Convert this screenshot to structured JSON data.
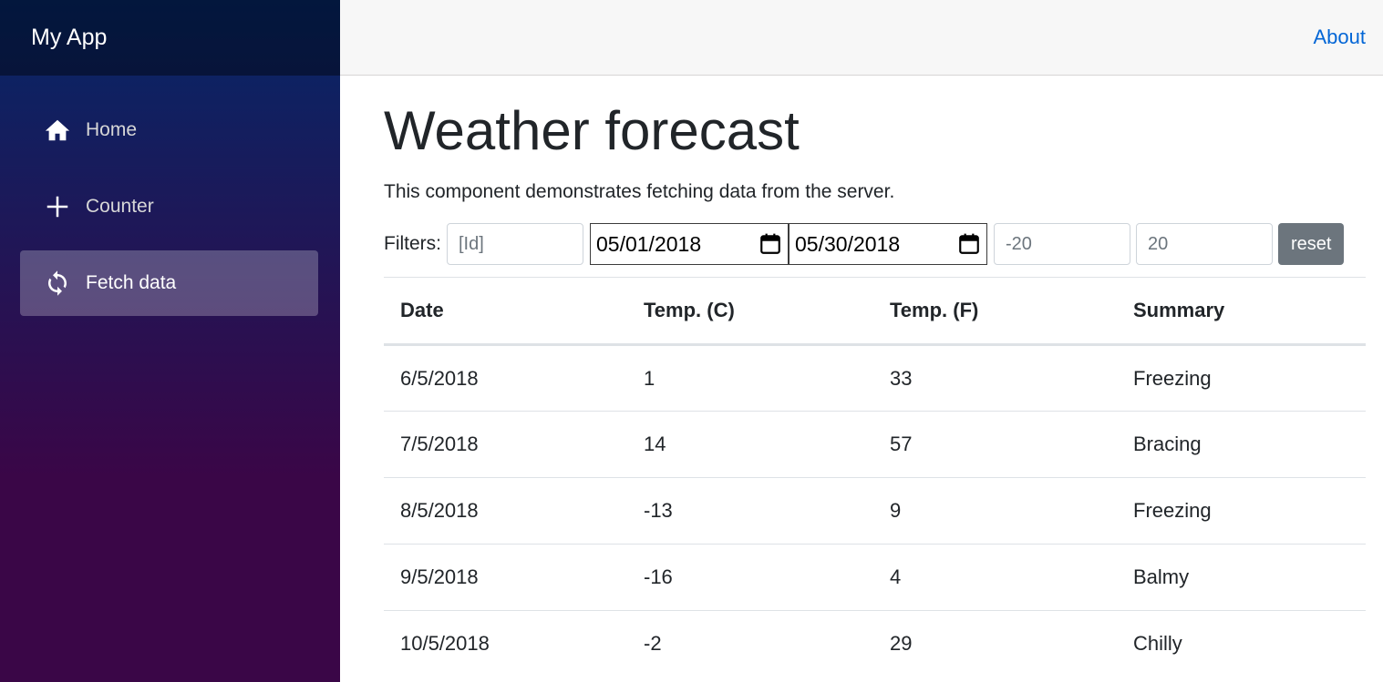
{
  "brand": "My App",
  "sidebar": {
    "items": [
      {
        "label": "Home",
        "icon": "home-icon",
        "active": false
      },
      {
        "label": "Counter",
        "icon": "plus-icon",
        "active": false
      },
      {
        "label": "Fetch data",
        "icon": "refresh-icon",
        "active": true
      }
    ]
  },
  "topbar": {
    "about_label": "About"
  },
  "page": {
    "title": "Weather forecast",
    "description": "This component demonstrates fetching data from the server."
  },
  "filters": {
    "label": "Filters:",
    "id_placeholder": "[Id]",
    "date_from": "05/01/2018",
    "date_to": "05/30/2018",
    "temp_min_placeholder": "-20",
    "temp_max_placeholder": "20",
    "reset_label": "reset"
  },
  "table": {
    "headers": [
      "Date",
      "Temp. (C)",
      "Temp. (F)",
      "Summary"
    ],
    "rows": [
      [
        "6/5/2018",
        "1",
        "33",
        "Freezing"
      ],
      [
        "7/5/2018",
        "14",
        "57",
        "Bracing"
      ],
      [
        "8/5/2018",
        "-13",
        "9",
        "Freezing"
      ],
      [
        "9/5/2018",
        "-16",
        "4",
        "Balmy"
      ],
      [
        "10/5/2018",
        "-2",
        "29",
        "Chilly"
      ]
    ]
  },
  "colors": {
    "sidebar_top": "#052767",
    "sidebar_bottom": "#3a0647",
    "link": "#0366d6",
    "reset_button": "#6c757d"
  }
}
